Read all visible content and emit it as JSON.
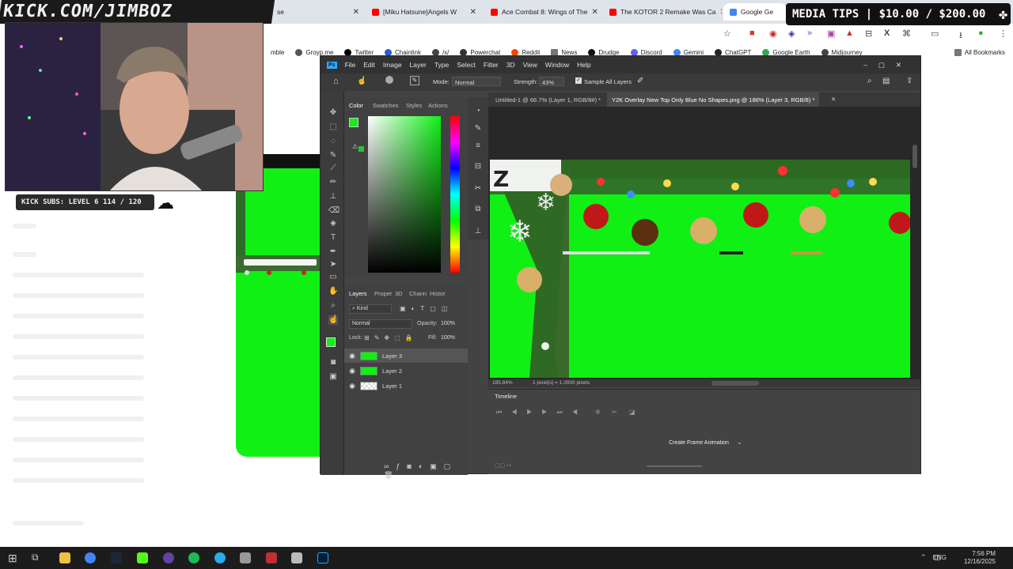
{
  "overlay": {
    "kick_url": "KICK.COM/JIMBOZ",
    "media_tips": "MEDIA TIPS | $10.00 / $200.00",
    "kick_subs": "KICK SUBS: LEVEL 6 114 / 120"
  },
  "browser": {
    "tabs": [
      {
        "label": "se",
        "color": "#888888"
      },
      {
        "label": "[Miku Hatsune]Angels W",
        "color": "#ff0000"
      },
      {
        "label": "Ace Combat 8: Wings of The",
        "color": "#ff0000"
      },
      {
        "label": "The KOTOR 2 Remake Was Ca",
        "color": "#ff0000"
      },
      {
        "label": "Google Ge",
        "color": "#4285f4"
      }
    ],
    "bookmarks": [
      {
        "label": "mble",
        "color": "#ffffff"
      },
      {
        "label": "Groyp.me",
        "color": "#555555"
      },
      {
        "label": "Twitter",
        "color": "#000000"
      },
      {
        "label": "Chainlink",
        "color": "#2a5ada"
      },
      {
        "label": "/x/",
        "color": "#444444"
      },
      {
        "label": "Powerchat",
        "color": "#333333"
      },
      {
        "label": "Reddit",
        "color": "#ff4500"
      },
      {
        "label": "News",
        "color": "#777777"
      },
      {
        "label": "Drudge",
        "color": "#111111"
      },
      {
        "label": "Discord",
        "color": "#5865f2"
      },
      {
        "label": "Gemini",
        "color": "#4285f4"
      },
      {
        "label": "ChatGPT",
        "color": "#222222"
      },
      {
        "label": "Google Earth",
        "color": "#34a853"
      },
      {
        "label": "Midjourney",
        "color": "#444444"
      }
    ],
    "all_bookmarks": "All Bookmarks"
  },
  "ps": {
    "menu": [
      "File",
      "Edit",
      "Image",
      "Layer",
      "Type",
      "Select",
      "Filter",
      "3D",
      "View",
      "Window",
      "Help"
    ],
    "options": {
      "mode_label": "Mode:",
      "mode_value": "Normal",
      "strength_label": "Strength:",
      "strength_value": "43%",
      "sample_all": "Sample All Layers"
    },
    "color_tabs": [
      "Color",
      "Swatches",
      "Styles",
      "Actions"
    ],
    "layer_tabs": [
      "Layers",
      "Proper",
      "3D",
      "Chann",
      "Histor"
    ],
    "kind": "Kind",
    "blend": "Normal",
    "opacity_label": "Opacity:",
    "opacity": "100%",
    "lock_label": "Lock:",
    "fill_label": "Fill:",
    "fill": "100%",
    "layers": [
      {
        "name": "Layer 3",
        "thumb": "#10f015"
      },
      {
        "name": "Layer 2",
        "thumb": "#10f015"
      },
      {
        "name": "Layer 1",
        "thumb": "#f0f0f0"
      }
    ],
    "doc_tabs": [
      {
        "label": "Untitled-1 @ 66.7% (Layer 1, RGB/8#) *"
      },
      {
        "label": "Y2K Overlay New Top Only Blue No Shapes.png @ 186% (Layer 3, RGB/8) *"
      }
    ],
    "status": "185.84%",
    "status_pixels": "1 pixel(s) = 1.0000 pixels",
    "timeline_title": "Timeline",
    "create_frame": "Create Frame Animation"
  },
  "taskbar": {
    "lang": "ENG",
    "time": "7:56 PM",
    "date": "12/16/2025"
  }
}
